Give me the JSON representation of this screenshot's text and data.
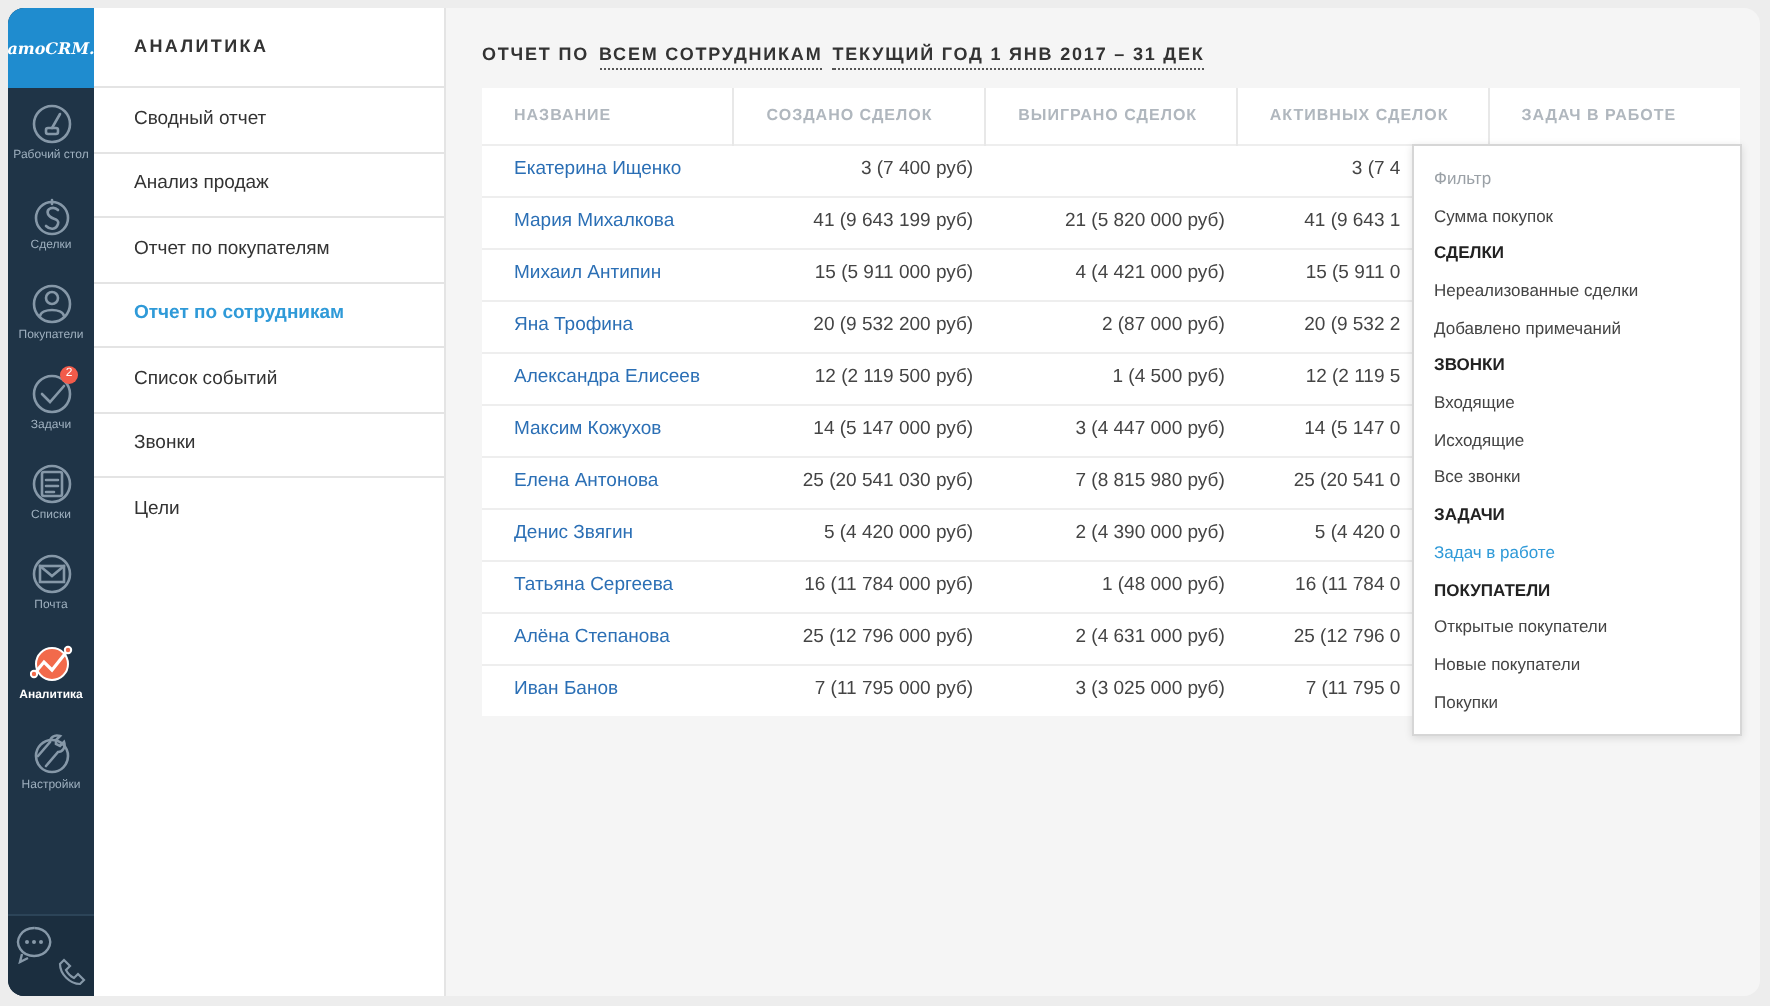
{
  "app_nav": {
    "logo": "amoCRM.",
    "items": [
      {
        "label": "Рабочий стол",
        "selected": false
      },
      {
        "label": "Сделки",
        "selected": false
      },
      {
        "label": "Покупатели",
        "selected": false
      },
      {
        "label": "Задачи",
        "selected": false,
        "badge": "2"
      },
      {
        "label": "Списки",
        "selected": false
      },
      {
        "label": "Почта",
        "selected": false
      },
      {
        "label": "Аналитика",
        "selected": true
      },
      {
        "label": "Настройки",
        "selected": false
      }
    ]
  },
  "section_menu": {
    "title": "АНАЛИТИКА",
    "items": [
      {
        "label": "Сводный отчет",
        "selected": false
      },
      {
        "label": "Анализ продаж",
        "selected": false
      },
      {
        "label": "Отчет по покупателям",
        "selected": false
      },
      {
        "label": "Отчет по сотрудникам",
        "selected": true
      },
      {
        "label": "Список событий",
        "selected": false
      },
      {
        "label": "Звонки",
        "selected": false
      },
      {
        "label": "Цели",
        "selected": false
      }
    ]
  },
  "report_header": {
    "prefix": "ОТЧЕТ ПО",
    "employees_filter": "ВСЕМ СОТРУДНИКАМ",
    "period_filter": "ТЕКУЩИЙ ГОД 1 ЯНВ 2017 – 31 ДЕК"
  },
  "table": {
    "columns": [
      "НАЗВАНИЕ",
      "СОЗДАНО СДЕЛОК",
      "ВЫИГРАНО СДЕЛОК",
      "АКТИВНЫХ СДЕЛОК",
      "ЗАДАЧ В РАБОТЕ"
    ],
    "rows": [
      {
        "name": "Екатерина Ищенко",
        "created": "3 (7 400 руб)",
        "won": "",
        "active": "3 (7 4"
      },
      {
        "name": "Мария Михалкова",
        "created": "41 (9 643 199 руб)",
        "won": "21 (5 820 000 руб)",
        "active": "41 (9 643 1"
      },
      {
        "name": "Михаил Антипин",
        "created": "15 (5 911 000 руб)",
        "won": "4 (4 421 000 руб)",
        "active": "15 (5 911 0"
      },
      {
        "name": "Яна Трофина",
        "created": "20 (9 532 200 руб)",
        "won": "2 (87 000 руб)",
        "active": "20 (9 532 2"
      },
      {
        "name": "Александра Елисеев",
        "created": "12 (2 119 500 руб)",
        "won": "1 (4 500 руб)",
        "active": "12 (2 119 5"
      },
      {
        "name": "Максим Кожухов",
        "created": "14 (5 147 000 руб)",
        "won": "3 (4 447 000 руб)",
        "active": "14 (5 147 0"
      },
      {
        "name": "Елена Антонова",
        "created": "25 (20 541 030 руб)",
        "won": "7 (8 815 980 руб)",
        "active": "25 (20 541 0"
      },
      {
        "name": "Денис Звягин",
        "created": "5 (4 420 000 руб)",
        "won": "2 (4 390 000 руб)",
        "active": "5 (4 420 0"
      },
      {
        "name": "Татьяна Сергеева",
        "created": "16 (11 784 000 руб)",
        "won": "1 (48 000 руб)",
        "active": "16 (11 784 0"
      },
      {
        "name": "Алёна Степанова",
        "created": "25 (12 796 000 руб)",
        "won": "2 (4 631 000 руб)",
        "active": "25 (12 796 0"
      },
      {
        "name": "Иван Банов",
        "created": "7 (11 795 000 руб)",
        "won": "3 (3 025 000 руб)",
        "active": "7 (11 795 0"
      }
    ]
  },
  "column_dropdown": {
    "entries": [
      {
        "kind": "hint",
        "label": "Фильтр"
      },
      {
        "kind": "option",
        "label": "Сумма покупок",
        "selected": false
      },
      {
        "kind": "group",
        "label": "СДЕЛКИ"
      },
      {
        "kind": "option",
        "label": "Нереализованные сделки",
        "selected": false
      },
      {
        "kind": "option",
        "label": "Добавлено примечаний",
        "selected": false
      },
      {
        "kind": "group",
        "label": "ЗВОНКИ"
      },
      {
        "kind": "option",
        "label": "Входящие",
        "selected": false
      },
      {
        "kind": "option",
        "label": "Исходящие",
        "selected": false
      },
      {
        "kind": "option",
        "label": "Все звонки",
        "selected": false
      },
      {
        "kind": "group",
        "label": "ЗАДАЧИ"
      },
      {
        "kind": "option",
        "label": "Задач в работе",
        "selected": true
      },
      {
        "kind": "group",
        "label": "ПОКУПАТЕЛИ"
      },
      {
        "kind": "option",
        "label": "Открытые покупатели",
        "selected": false
      },
      {
        "kind": "option",
        "label": "Новые покупатели",
        "selected": false
      },
      {
        "kind": "option",
        "label": "Покупки",
        "selected": false
      }
    ]
  }
}
